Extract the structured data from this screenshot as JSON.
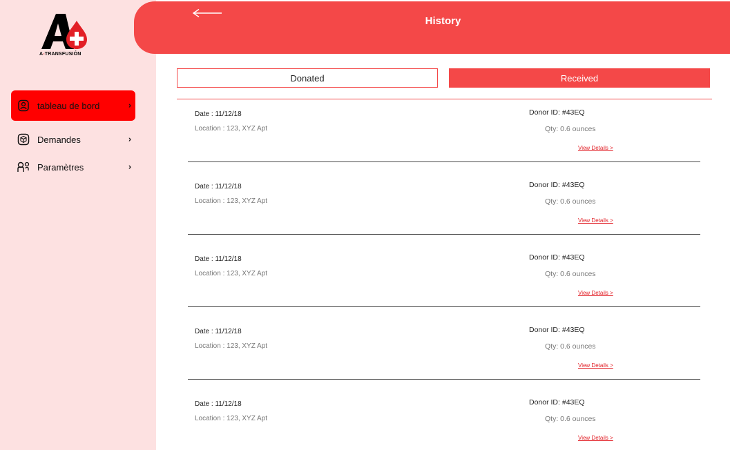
{
  "app": {
    "logo_text_prefix": "A",
    "logo_text_dash": "-",
    "logo_text_main": "TRANSFUSIÓN"
  },
  "sidebar": {
    "items": [
      {
        "label": "tableau de bord",
        "icon": "user-circle-icon",
        "active": true
      },
      {
        "label": "Demandes",
        "icon": "box-icon",
        "active": false
      },
      {
        "label": "Paramètres",
        "icon": "settings-people-icon",
        "active": false
      }
    ],
    "chevron": "›"
  },
  "header": {
    "title": "History",
    "back_icon": "arrow-left-icon"
  },
  "tabs": [
    {
      "label": "Donated",
      "selected": false
    },
    {
      "label": "Received",
      "selected": true
    }
  ],
  "records": [
    {
      "date": "Date : 11/12/18",
      "location": "Location : 123, XYZ Apt",
      "donor": "Donor ID: #43EQ",
      "qty": "Qty: 0.6 ounces",
      "link": "View Details >"
    },
    {
      "date": "Date : 11/12/18",
      "location": "Location : 123, XYZ Apt",
      "donor": "Donor ID: #43EQ",
      "qty": "Qty: 0.6 ounces",
      "link": "View Details >"
    },
    {
      "date": "Date : 11/12/18",
      "location": "Location : 123, XYZ Apt",
      "donor": "Donor ID: #43EQ",
      "qty": "Qty: 0.6 ounces",
      "link": "View Details >"
    },
    {
      "date": "Date : 11/12/18",
      "location": "Location : 123, XYZ Apt",
      "donor": "Donor ID: #43EQ",
      "qty": "Qty: 0.6 ounces",
      "link": "View Details >"
    },
    {
      "date": "Date : 11/12/18",
      "location": "Location : 123, XYZ Apt",
      "donor": "Donor ID: #43EQ",
      "qty": "Qty: 0.6 ounces",
      "link": "View Details >"
    }
  ],
  "colors": {
    "accent": "#f44848",
    "active_nav": "#ff0000",
    "sidebar_bg": "#fde1e1"
  }
}
